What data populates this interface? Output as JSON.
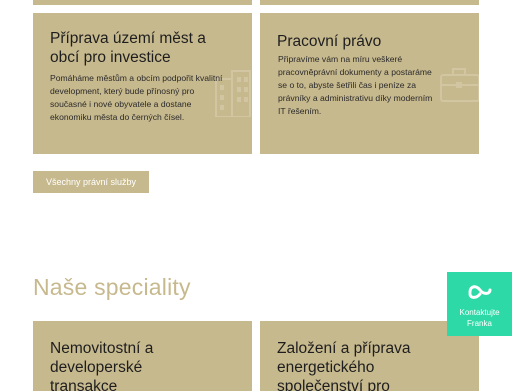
{
  "services": {
    "cards": [
      {
        "title": "Příprava území měst a obcí pro investice",
        "text": "Pomáháme městům a obcím podpořit kvalitní development, který bude přínosný pro současné i nové obyvatele a dostane ekonomiku města do černých čísel.",
        "icon": "building-icon"
      },
      {
        "title": "Pracovní právo",
        "text": "Připravíme vám na míru veškeré pracovněprávní dokumenty a postaráme se o to, abyste šetřili čas i peníze za právníky a administrativu díky moderním IT řešením.",
        "icon": "briefcase-icon"
      }
    ],
    "all_services_label": "Všechny právní služby"
  },
  "specialities": {
    "heading": "Naše speciality",
    "cards": [
      {
        "title": "Nemovitostní a developerské transakce"
      },
      {
        "title": "Založení a příprava energetického společenství pro"
      }
    ]
  },
  "contact_widget": {
    "label": "Kontaktujte Franka",
    "icon": "chat-logo-icon"
  },
  "colors": {
    "card_bg": "#c7b98e",
    "heading": "#c7b98e",
    "widget_bg": "#2ed9a8",
    "text": "#1e1e1e"
  }
}
